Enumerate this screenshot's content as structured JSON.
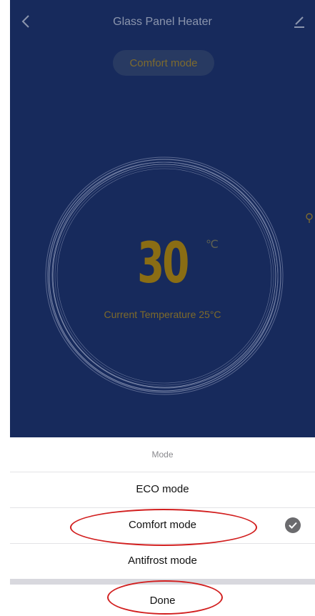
{
  "header": {
    "title": "Glass Panel Heater",
    "back_icon": "chevron-left-icon",
    "edit_icon": "pencil-icon"
  },
  "mode_badge": "Comfort mode",
  "thermostat": {
    "target_temp": "30",
    "unit": "℃",
    "current_temp_text": "Current Temperature 25°C"
  },
  "side_icon": "bulb-icon",
  "sheet": {
    "title": "Mode",
    "options": [
      {
        "label": "ECO mode",
        "selected": false
      },
      {
        "label": "Comfort mode",
        "selected": true
      },
      {
        "label": "Antifrost mode",
        "selected": false
      }
    ],
    "done_label": "Done"
  },
  "colors": {
    "app_background": "#172a5c",
    "accent": "#8a6d14",
    "annotation": "#d21f1f"
  }
}
